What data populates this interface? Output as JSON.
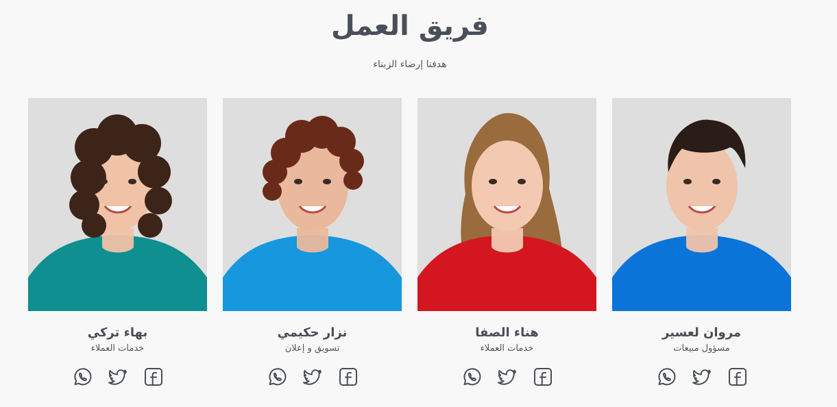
{
  "section": {
    "title": "فريق العمل",
    "subtitle": "هدفنا إرضاء الزبناء"
  },
  "members": [
    {
      "name": "مروان لعسير",
      "role": "مسؤول مبيعات",
      "shirt_color": "#0a74d9",
      "hair_color": "#2a1c16",
      "skin_color": "#f0c3ab"
    },
    {
      "name": "هناء الصفا",
      "role": "خدمات العملاء",
      "shirt_color": "#d3161f",
      "hair_color": "#9a6b3d",
      "skin_color": "#f3c9b2"
    },
    {
      "name": "نزار حكيمي",
      "role": "تسويق و إعلان",
      "shirt_color": "#1797dd",
      "hair_color": "#6a2a1a",
      "skin_color": "#eab89c"
    },
    {
      "name": "بهاء تركي",
      "role": "خدمات العملاء",
      "shirt_color": "#0f8f8f",
      "hair_color": "#3d2418",
      "skin_color": "#f0c2a6"
    }
  ],
  "social_icons": [
    "whatsapp-icon",
    "twitter-icon",
    "facebook-icon"
  ],
  "colors": {
    "background": "#f8f8f8",
    "text": "#4a4d57",
    "photo_bg": "#dedede",
    "icon": "#4a4d57"
  }
}
